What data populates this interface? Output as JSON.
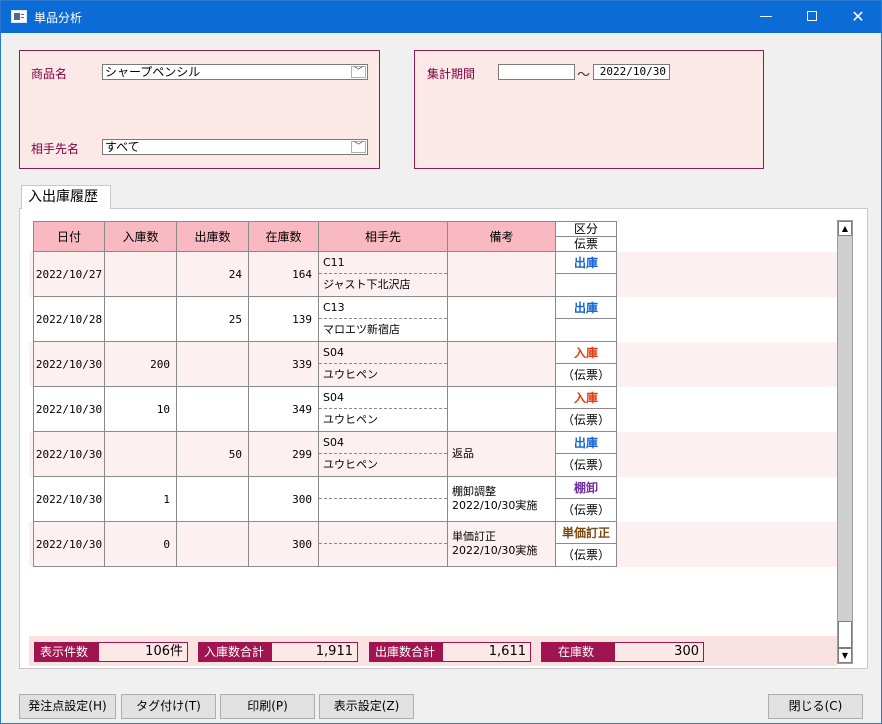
{
  "window": {
    "title": "単品分析"
  },
  "product": {
    "label": "商品名",
    "value": "シャープペンシル"
  },
  "partner": {
    "label": "相手先名",
    "value": "すべて"
  },
  "period": {
    "label": "集計期間",
    "from": "",
    "separator": "～",
    "to": "2022/10/30"
  },
  "tab": {
    "label": "入出庫履歴"
  },
  "table": {
    "headers": {
      "date": "日付",
      "in": "入庫数",
      "out": "出庫数",
      "stock": "在庫数",
      "partner": "相手先",
      "note": "備考"
    },
    "rows": [
      {
        "date": "2022/10/27",
        "in": "",
        "out": "24",
        "stock": "164",
        "code": "C11",
        "name": "ジャスト下北沢店",
        "note1": "",
        "note2": ""
      },
      {
        "date": "2022/10/28",
        "in": "",
        "out": "25",
        "stock": "139",
        "code": "C13",
        "name": "マロエツ新宿店",
        "note1": "",
        "note2": ""
      },
      {
        "date": "2022/10/30",
        "in": "200",
        "out": "",
        "stock": "339",
        "code": "S04",
        "name": "ユウヒペン",
        "note1": "",
        "note2": ""
      },
      {
        "date": "2022/10/30",
        "in": "10",
        "out": "",
        "stock": "349",
        "code": "S04",
        "name": "ユウヒペン",
        "note1": "",
        "note2": ""
      },
      {
        "date": "2022/10/30",
        "in": "",
        "out": "50",
        "stock": "299",
        "code": "S04",
        "name": "ユウヒペン",
        "note1": "返品",
        "note2": ""
      },
      {
        "date": "2022/10/30",
        "in": "1",
        "out": "",
        "stock": "300",
        "code": "",
        "name": "",
        "note1": "棚卸調整",
        "note2": "2022/10/30実施"
      },
      {
        "date": "2022/10/30",
        "in": "0",
        "out": "",
        "stock": "300",
        "code": "",
        "name": "",
        "note1": "単価訂正",
        "note2": "2022/10/30実施"
      }
    ]
  },
  "kubun": {
    "header1": "区分",
    "header2": "伝票",
    "rows": [
      {
        "type": "出庫",
        "slip": ""
      },
      {
        "type": "出庫",
        "slip": ""
      },
      {
        "type": "入庫",
        "slip": "（伝票）"
      },
      {
        "type": "入庫",
        "slip": "（伝票）"
      },
      {
        "type": "出庫",
        "slip": "（伝票）"
      },
      {
        "type": "棚卸",
        "slip": "（伝票）"
      },
      {
        "type": "単価訂正",
        "slip": "（伝票）"
      }
    ]
  },
  "summary": {
    "count_label": "表示件数",
    "count_value": "106件",
    "in_label": "入庫数合計",
    "in_value": "1,911",
    "out_label": "出庫数合計",
    "out_value": "1,611",
    "stock_label": "在庫数",
    "stock_value": "300"
  },
  "buttons": {
    "order_point": "発注点設定(H)",
    "tag": "タグ付け(T)",
    "print": "印刷(P)",
    "display": "表示設定(Z)",
    "close": "閉じる(C)"
  },
  "colors": {
    "accent": "#a0154f",
    "header_bg": "#f9b9c2",
    "panel_bg": "#fde8e8",
    "out": "#1565d8",
    "in": "#e03b10"
  }
}
